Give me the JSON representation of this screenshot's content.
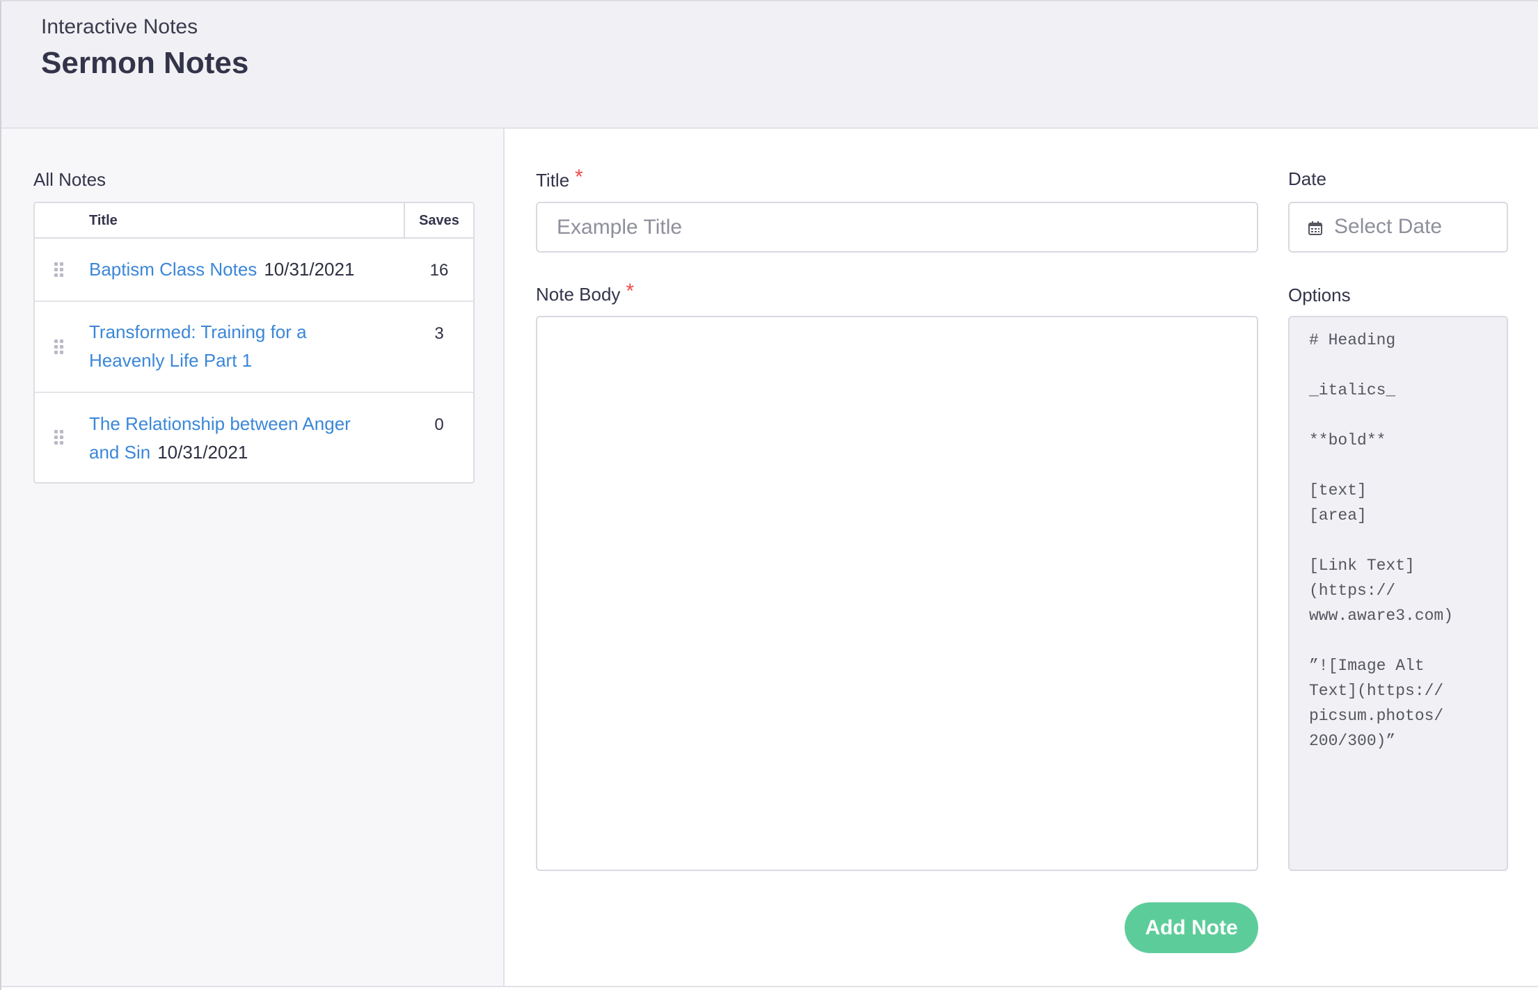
{
  "header": {
    "subtitle": "Interactive Notes",
    "title": "Sermon Notes"
  },
  "sidebar": {
    "section_label": "All Notes",
    "table": {
      "columns": [
        "Title",
        "Saves"
      ],
      "rows": [
        {
          "title": "Baptism Class Notes",
          "date": "10/31/2021",
          "saves": "16"
        },
        {
          "title": "Transformed: Training for a Heavenly Life Part 1",
          "date": "",
          "saves": "3"
        },
        {
          "title": "The Relationship between Anger and Sin",
          "date": "10/31/2021",
          "saves": "0"
        }
      ]
    }
  },
  "form": {
    "title_label": "Title",
    "title_placeholder": "Example Title",
    "date_label": "Date",
    "date_placeholder": "Select Date",
    "body_label": "Note Body",
    "body_value": "",
    "options_label": "Options",
    "options_text": "# Heading\n\n_italics_\n\n**bold**\n\n[text]\n[area]\n\n[Link Text]\n(https://\nwww.aware3.com)\n\n”![Image Alt\nText](https://\npicsum.photos/\n200/300)”",
    "required_marker": "*",
    "submit_label": "Add Note"
  },
  "colors": {
    "link": "#3b87d8",
    "accent_button": "#5dcc9b",
    "required": "#ee4c4c",
    "header_bg": "#f1f1f5"
  },
  "icons": {
    "drag_handle": "drag-handle-icon",
    "calendar": "calendar-icon"
  }
}
